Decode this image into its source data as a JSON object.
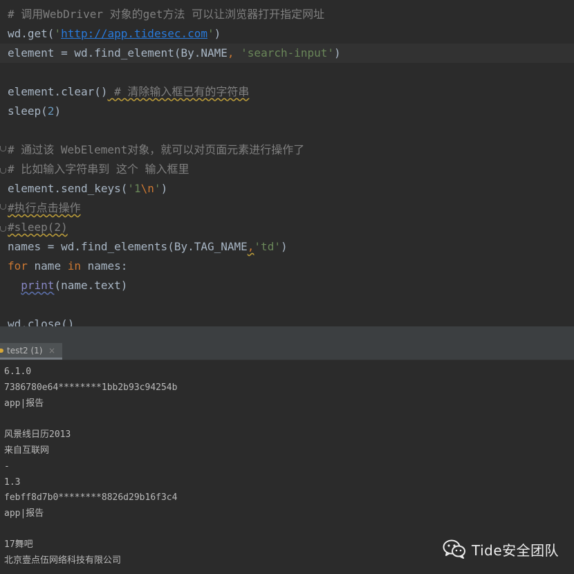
{
  "editor": {
    "lines": [
      {
        "comment": "# 调用WebDriver 对象的get方法 可以让浏览器打开指定网址"
      },
      {
        "pre": "wd.get(",
        "q1": "'",
        "url": "http://app.tidesec.com",
        "q2": "'",
        "post": ")"
      },
      {
        "pre": "element = wd.find_element(By.NAME",
        "comma": ",",
        "str": " 'search-input'",
        "post": ")"
      },
      {
        "text": ""
      },
      {
        "pre": "element.clear()",
        "comment": " # 清除输入框已有的字符串"
      },
      {
        "pre": "sleep(",
        "num": "2",
        "post": ")"
      },
      {
        "text": ""
      },
      {
        "comment": "# 通过该 WebElement对象，就可以对页面元素进行操作了"
      },
      {
        "comment": "# 比如输入字符串到 这个 输入框里"
      },
      {
        "pre": "element.send_keys(",
        "str1": "'1",
        "esc": "\\n",
        "str2": "'",
        "post": ")"
      },
      {
        "comment": "#执行点击操作"
      },
      {
        "comment": "#sleep(2)"
      },
      {
        "pre": "names = wd.find_elements(By.TAG_NAME",
        "comma": ",",
        "str": "'td'",
        "post": ")"
      },
      {
        "kw1": "for",
        "mid1": " name ",
        "kw2": "in",
        "mid2": " names:"
      },
      {
        "indent": "  ",
        "builtin": "print",
        "post": "(name.text)"
      },
      {
        "text": ""
      },
      {
        "pre": "wd.close()"
      }
    ]
  },
  "run_panel": {
    "tab_label": "test2 (1)",
    "tab_close": "×",
    "output": [
      "6.1.0",
      "7386780e64********1bb2b93c94254b",
      "app|报告",
      "",
      "风景线日历2013",
      "来自互联网",
      "-",
      "1.3",
      "febff8d7b0********8826d29b16f3c4",
      "app|报告",
      "",
      "17舞吧",
      "北京壹点伍网络科技有限公司"
    ]
  },
  "watermark": {
    "icon": "wechat-icon",
    "text": "Tide安全团队"
  },
  "colors": {
    "editor_bg": "#2b2b2b",
    "comment": "#808080",
    "keyword": "#cc7832",
    "string": "#6a8759",
    "number": "#6897bb",
    "url": "#287bde"
  }
}
